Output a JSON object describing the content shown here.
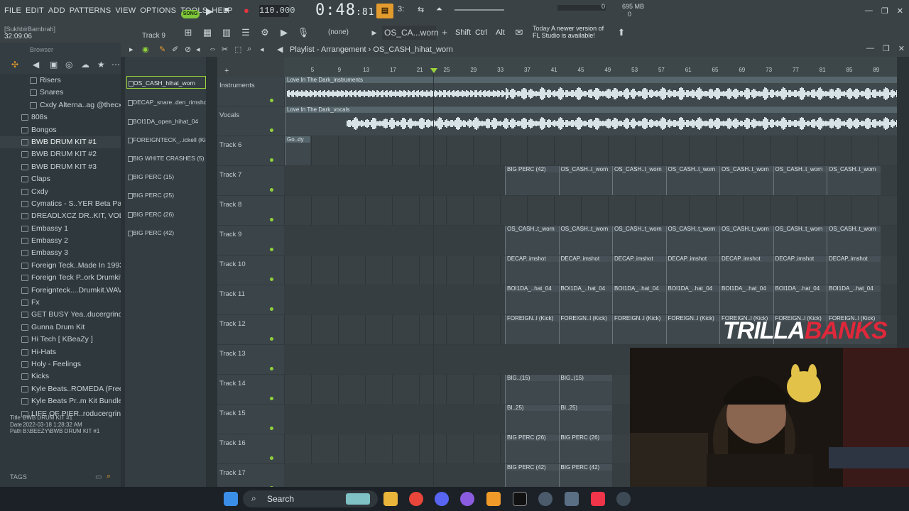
{
  "menu": [
    "FILE",
    "EDIT",
    "ADD",
    "PATTERNS",
    "VIEW",
    "OPTIONS",
    "TOOLS",
    "HELP"
  ],
  "transport": {
    "mode": "SONG",
    "tempo": "110.000",
    "time_main": "0:48",
    "time_sub": "81"
  },
  "ram": {
    "mb": "695 MB",
    "cpu": "0",
    "poly": "0"
  },
  "project": {
    "user": "[SukhbirBambrah]",
    "time": "32:09:06",
    "hint_track": "Track 9"
  },
  "toolbar2": {
    "pattern_name": "OS_CA...worn",
    "none_label": "(none)",
    "shift": "Shift",
    "ctrl": "Ctrl",
    "alt": "Alt",
    "news_today": "Today",
    "news_line1": "A newer version of",
    "news_line2": "FL Studio is available!"
  },
  "browser": {
    "title": "Browser",
    "items": [
      {
        "label": "Risers",
        "sub": true
      },
      {
        "label": "Snares",
        "sub": true
      },
      {
        "label": "Cxdy Alterna..ag @thecxdy",
        "sub": true
      },
      {
        "label": "808s"
      },
      {
        "label": "Bongos"
      },
      {
        "label": "BWB DRUM KIT #1",
        "selected": true
      },
      {
        "label": "BWB DRUM KIT #2"
      },
      {
        "label": "BWB DRUM KIT #3"
      },
      {
        "label": "Claps"
      },
      {
        "label": "Cxdy"
      },
      {
        "label": "Cymatics - S..YER Beta Pack"
      },
      {
        "label": "DREADLXCZ DR..KIT, VOL. 1"
      },
      {
        "label": "Embassy 1"
      },
      {
        "label": "Embassy 2"
      },
      {
        "label": "Embassy 3"
      },
      {
        "label": "Foreign Teck..Made In 1993"
      },
      {
        "label": "Foreign Teck P..ork Drumkit"
      },
      {
        "label": "Foreignteck....Drumkit.WAV"
      },
      {
        "label": "Fx"
      },
      {
        "label": "GET BUSY Yea..ducergrind)"
      },
      {
        "label": "Gunna Drum Kit"
      },
      {
        "label": "Hi Tech [ KBeaZy ]"
      },
      {
        "label": "Hi-Hats"
      },
      {
        "label": "Holy - Feelings"
      },
      {
        "label": "Kicks"
      },
      {
        "label": "Kyle Beats..ROMEDA (Free)"
      },
      {
        "label": "Kyle Beats Pr..m Kit Bundle"
      },
      {
        "label": "LIFE OF PIER..roducergrind)"
      }
    ],
    "info": {
      "title_k": "Title",
      "title_v": "BWB DRUM KIT #1",
      "date_k": "Date",
      "date_v": "2022-03-18 1:28:32 AM",
      "path_k": "Path",
      "path_v": "B:\\BEEZY\\BWB DRUM KIT #1"
    },
    "tags": "TAGS"
  },
  "playlist": {
    "title": "Playlist - Arrangement",
    "pattern": "OS_CASH_hihat_worn"
  },
  "picker": [
    "OS_CASH_hihat_worn",
    "DECAP_snare..den_rimshot",
    "BOI1DA_open_hihat_04",
    "FOREIGNTECK_..ickell (Kick)",
    "BIG WHITE CRASHES (5)",
    "BIG PERC (15)",
    "BIG PERC (25)",
    "BIG PERC (26)",
    "BIG PERC (42)"
  ],
  "ruler": [
    "5",
    "9",
    "13",
    "17",
    "21",
    "25",
    "29",
    "33",
    "37",
    "41",
    "45",
    "49",
    "53",
    "57",
    "61",
    "65",
    "69",
    "73",
    "77",
    "81",
    "85",
    "89"
  ],
  "tracks": [
    "Instruments",
    "Vocals",
    "Track 6",
    "Track 7",
    "Track 8",
    "Track 9",
    "Track 10",
    "Track 11",
    "Track 12",
    "Track 13",
    "Track 14",
    "Track 15",
    "Track 16",
    "Track 17"
  ],
  "audio_clips": {
    "instruments": "Love In The Dark_instruments",
    "vocals": "Love In The Dark_vocals",
    "track6": "Go..dy"
  },
  "row_labels": {
    "t7_first": "BIG PERC (42)",
    "t7_rest": "OS_CASH..t_worn",
    "t9": "OS_CASH..t_worn",
    "t10": "DECAP..imshot",
    "t11": "BOI1DA_..hat_04",
    "t12": "FOREIGN..l (Kick)",
    "t14": "BIG..(15)",
    "t14b": "BIG",
    "t15": "BI..25)",
    "t15b": "BI..2",
    "t16": "BIG PERC (26)",
    "t16b": "BIG",
    "t17": "BIG PERC (42)",
    "t17b": "BIG"
  },
  "overlay": {
    "logo_white": "TRILLA",
    "logo_red": "BANKS"
  },
  "taskbar": {
    "search_placeholder": "Search"
  },
  "colors": {
    "accent_green": "#8fd23a",
    "accent_orange": "#e39b2d",
    "logo_red": "#e0283a"
  }
}
